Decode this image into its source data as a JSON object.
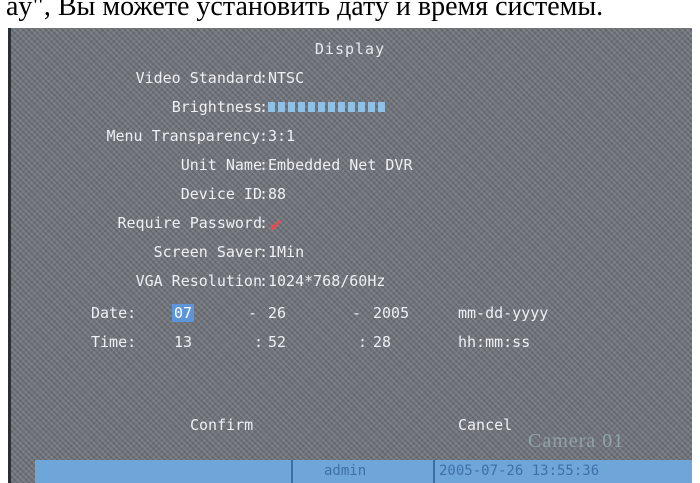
{
  "caption": "ay\", Вы можете установить дату и время системы.",
  "title": "Display",
  "fields": {
    "video_standard": {
      "label": "Video Standard",
      "value": "NTSC"
    },
    "brightness": {
      "label": "Brightness",
      "level": 1.0
    },
    "menu_transparency": {
      "label": "Menu Transparency",
      "value": "3:1"
    },
    "unit_name": {
      "label": "Unit Name",
      "value": "Embedded Net DVR"
    },
    "device_id": {
      "label": "Device ID",
      "value": "88"
    },
    "require_password": {
      "label": "Require Password",
      "checked": true,
      "check_icon": "checkmark-icon"
    },
    "screen_saver": {
      "label": "Screen Saver",
      "value": "1Min"
    },
    "vga_resolution": {
      "label": "VGA Resolution",
      "value": "1024*768/60Hz"
    }
  },
  "date": {
    "label": "Date:",
    "month": "07",
    "sep1": "-",
    "day": "26",
    "sep2": "-",
    "year": "2005",
    "format": "mm-dd-yyyy"
  },
  "time": {
    "label": "Time:",
    "hour": "13",
    "sep1": ":",
    "minute": "52",
    "sep2": ":",
    "second": "28",
    "format": "hh:mm:ss"
  },
  "buttons": {
    "confirm": "Confirm",
    "cancel": "Cancel"
  },
  "overlay": {
    "camera": "Camera 01"
  },
  "status_bar": {
    "user": "admin",
    "datetime": "2005-07-26 13:55:36"
  },
  "colors": {
    "background": "#6f747a",
    "text": "#eef0f3",
    "highlight": "#5c96d8",
    "check": "#ea4b52",
    "status_bar": "#6fa6d9"
  }
}
